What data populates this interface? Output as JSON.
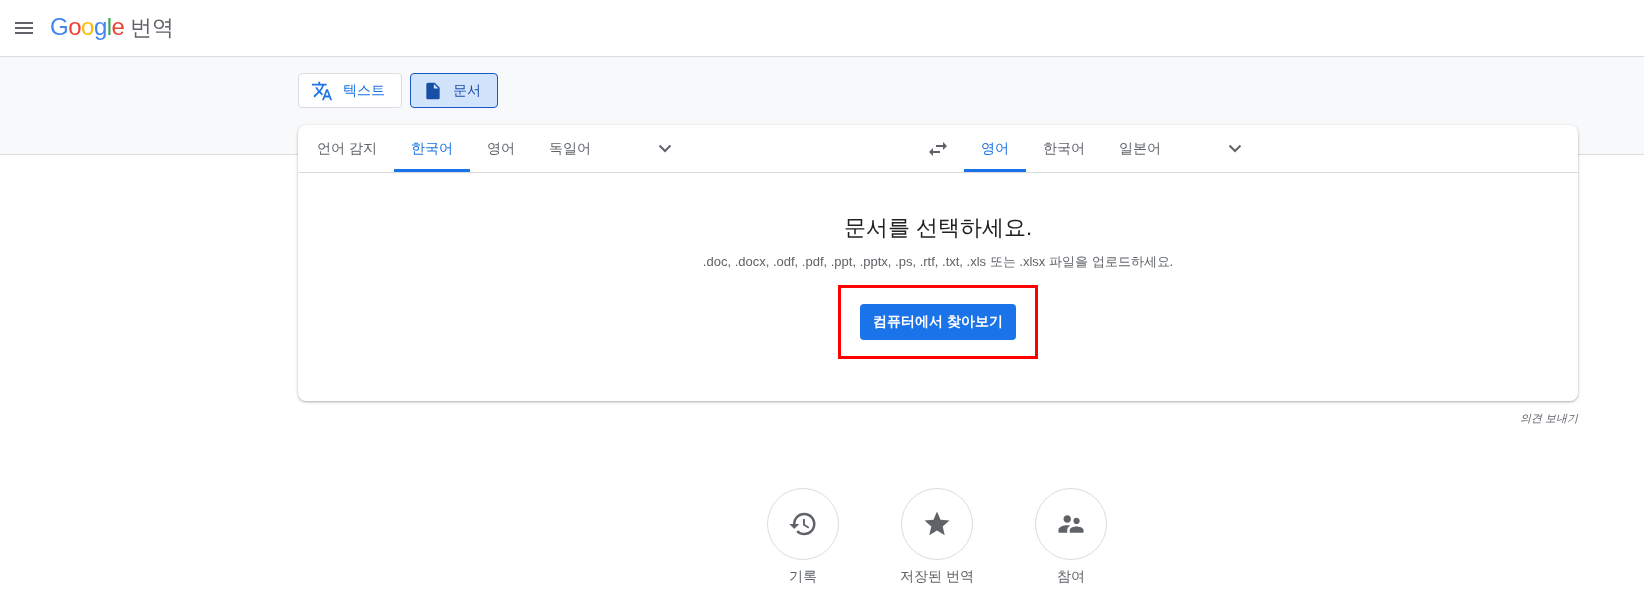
{
  "header": {
    "logo": "Google",
    "product": "번역"
  },
  "modes": [
    {
      "label": "텍스트",
      "kind": "text",
      "selected": false
    },
    {
      "label": "문서",
      "kind": "document",
      "selected": true
    }
  ],
  "source_languages": [
    {
      "label": "언어 감지",
      "selected": false
    },
    {
      "label": "한국어",
      "selected": true
    },
    {
      "label": "영어",
      "selected": false
    },
    {
      "label": "독일어",
      "selected": false
    }
  ],
  "target_languages": [
    {
      "label": "영어",
      "selected": true
    },
    {
      "label": "한국어",
      "selected": false
    },
    {
      "label": "일본어",
      "selected": false
    }
  ],
  "upload": {
    "title": "문서를 선택하세요.",
    "description": ".doc, .docx, .odf, .pdf, .ppt, .pptx, .ps, .rtf, .txt, .xls 또는 .xlsx 파일을 업로드하세요.",
    "button": "컴퓨터에서 찾아보기",
    "highlighted": true
  },
  "feedback": "의견 보내기",
  "shortcuts": [
    {
      "label": "기록",
      "kind": "history"
    },
    {
      "label": "저장된 번역",
      "kind": "saved"
    },
    {
      "label": "참여",
      "kind": "community"
    }
  ]
}
